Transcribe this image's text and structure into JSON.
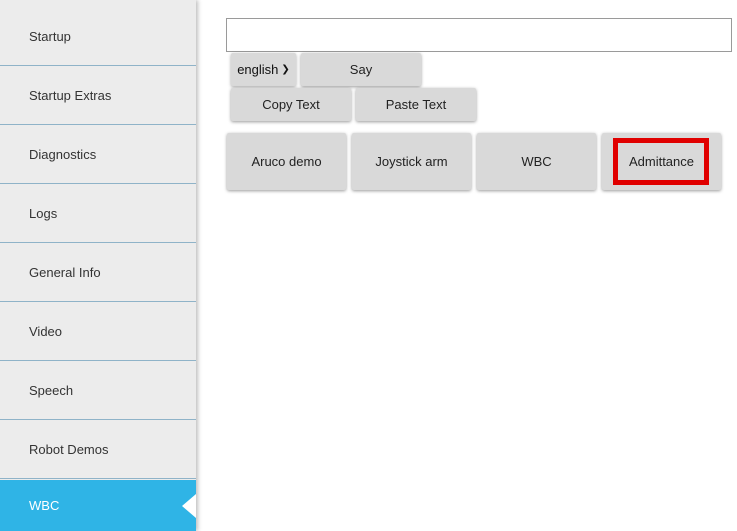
{
  "sidebar": {
    "items": [
      {
        "label": "Startup",
        "active": false
      },
      {
        "label": "Startup Extras",
        "active": false
      },
      {
        "label": "Diagnostics",
        "active": false
      },
      {
        "label": "Logs",
        "active": false
      },
      {
        "label": "General Info",
        "active": false
      },
      {
        "label": "Video",
        "active": false
      },
      {
        "label": "Speech",
        "active": false
      },
      {
        "label": "Robot Demos",
        "active": false
      },
      {
        "label": "WBC",
        "active": true
      }
    ]
  },
  "speech": {
    "text_value": "",
    "language": "english",
    "say_label": "Say",
    "copy_label": "Copy Text",
    "paste_label": "Paste Text"
  },
  "demos": {
    "buttons": [
      "Aruco demo",
      "Joystick arm",
      "WBC",
      "Admittance"
    ],
    "highlighted": "Admittance"
  },
  "colors": {
    "sidebar_bg": "#ececec",
    "active_bg": "#2fb4e6",
    "divider": "#8fb3c8",
    "button_bg": "#d9d9d9",
    "highlight": "#e00000"
  }
}
